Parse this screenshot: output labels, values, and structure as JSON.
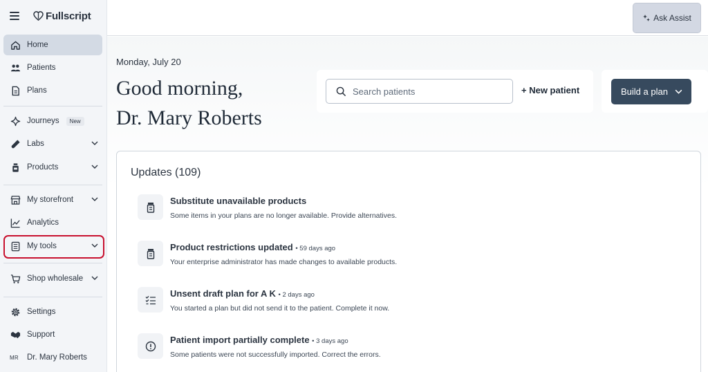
{
  "brand": {
    "name": "Fullscript"
  },
  "sidebar": {
    "items": [
      {
        "label": "Home",
        "icon": "home-icon"
      },
      {
        "label": "Patients",
        "icon": "users-icon"
      },
      {
        "label": "Plans",
        "icon": "document-icon"
      },
      {
        "label": "Journeys",
        "icon": "sparkle-icon",
        "badge": "New"
      },
      {
        "label": "Labs",
        "icon": "test-tube-icon"
      },
      {
        "label": "Products",
        "icon": "bottle-icon"
      },
      {
        "label": "My storefront",
        "icon": "store-icon"
      },
      {
        "label": "Analytics",
        "icon": "chart-line-icon"
      },
      {
        "label": "My tools",
        "icon": "tools-icon"
      },
      {
        "label": "Shop wholesale",
        "icon": "cart-icon"
      },
      {
        "label": "Settings",
        "icon": "gear-icon"
      },
      {
        "label": "Support",
        "icon": "handshake-icon"
      }
    ],
    "user": {
      "initials": "MR",
      "name": "Dr. Mary Roberts"
    }
  },
  "topbar": {
    "assist_label": "Ask Assist"
  },
  "main": {
    "date": "Monday, July 20",
    "greeting_line1": "Good morning,",
    "greeting_line2": "Dr. Mary Roberts",
    "search": {
      "placeholder": "Search patients"
    },
    "new_patient_label": "+ New patient",
    "build_plan_label": "Build a plan"
  },
  "updates": {
    "title": "Updates (109)",
    "items": [
      {
        "title": "Substitute unavailable products",
        "ago": "",
        "desc": "Some items in your plans are no longer available. Provide alternatives.",
        "icon": "bottle-icon"
      },
      {
        "title": "Product restrictions updated",
        "ago": "• 59 days ago",
        "desc": "Your enterprise administrator has made changes to available products.",
        "icon": "bottle-icon"
      },
      {
        "title": "Unsent draft plan for A K",
        "ago": "• 2 days ago",
        "desc": "You started a plan but did not send it to the patient. Complete it now.",
        "icon": "checklist-icon"
      },
      {
        "title": "Patient import partially complete",
        "ago": "• 3 days ago",
        "desc": "Some patients were not successfully imported. Correct the errors.",
        "icon": "alert-circle-icon"
      }
    ]
  },
  "colors": {
    "highlight": "#c8102e",
    "primary_button": "#374a5e",
    "active_nav": "#d3dae4"
  }
}
